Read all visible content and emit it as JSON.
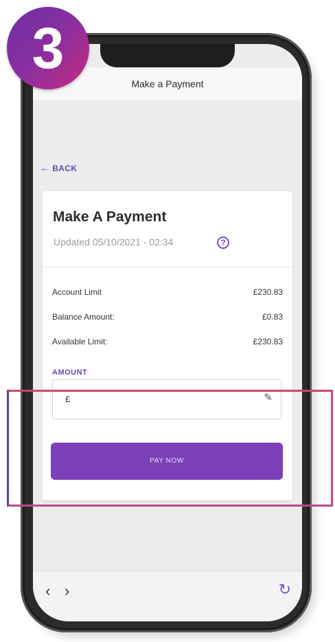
{
  "step_number": "3",
  "phone": {
    "header_title": "Make a Payment",
    "back_label": "BACK",
    "card": {
      "title": "Make A Payment",
      "updated_text": "Updated 05/10/2021  - 02:34",
      "info_icon": "info-icon",
      "rows": [
        {
          "label": "Account Limit",
          "value": "£230.83"
        },
        {
          "label": "Balance Amount:",
          "value": "£0.83"
        },
        {
          "label": "Available Limit:",
          "value": "£230.83"
        }
      ],
      "amount_label": "AMOUNT",
      "currency_symbol": "£",
      "edit_icon": "pencil-icon",
      "pay_button_label": "PAY NOW"
    },
    "browser_bar": {
      "back_icon": "chevron-left-icon",
      "forward_icon": "chevron-right-icon",
      "refresh_icon": "refresh-icon"
    }
  },
  "colors": {
    "brand_purple": "#7c3fb8",
    "badge_gradient_start": "#6b2fa1",
    "badge_gradient_end": "#c52a7c",
    "highlight_border": "#c64a6a"
  }
}
